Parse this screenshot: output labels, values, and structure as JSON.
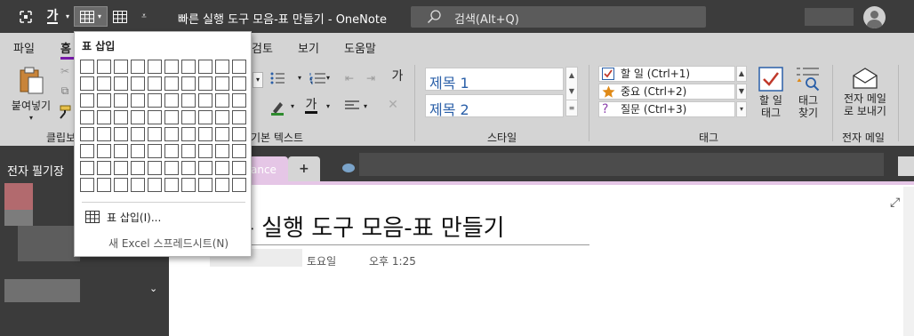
{
  "window": {
    "title": "빠른 실행 도구 모음-표 만들기  -  OneNote",
    "search_placeholder": "검색(Alt+Q)"
  },
  "quick_access": {
    "font_label": "가"
  },
  "ribbon_tabs": [
    "파일",
    "홈",
    "검토",
    "보기",
    "도움말"
  ],
  "ribbon": {
    "paste_label": "붙여넣기",
    "clipboard_group": "클립보",
    "basic_text_group": "기본 텍스트",
    "styles_group": "스타일",
    "tags_group": "태그",
    "email_group": "전자 메일",
    "text_a_label": "가",
    "style_heading1": "제목 1",
    "style_heading2": "제목 2",
    "tags": [
      {
        "label": "할 일 (Ctrl+1)",
        "icon": "checkbox-icon"
      },
      {
        "label": "중요 (Ctrl+2)",
        "icon": "star-icon"
      },
      {
        "label": "질문 (Ctrl+3)",
        "icon": "question-icon"
      }
    ],
    "todo_tag_button": [
      "할 일",
      "태그"
    ],
    "find_tags_button": [
      "태그",
      "찾기"
    ],
    "email_page_button": [
      "전자 메일",
      "로 보내기"
    ]
  },
  "table_dropdown": {
    "header": "표 삽입",
    "grid_rows": 8,
    "grid_cols": 10,
    "insert_table_item": "표 삽입(I)...",
    "new_excel_item": "새 Excel 스프레드시트(N)"
  },
  "left_nav": {
    "title": "전자 필기장"
  },
  "sections": {
    "partial_tab": "ance",
    "add_tab": "+"
  },
  "page": {
    "title": "빠른 실행 도구 모음-표 만들기",
    "visible_title": "른 실행 도구 모음-표 만들기",
    "day": "토요일",
    "time": "오후 1:25"
  },
  "colors": {
    "titlebar": "#3c3c3c",
    "ribbon": "#d4d4d4",
    "section_pink": "#e5c6e6",
    "accent_purple": "#7719aa",
    "style_blue": "#2a5fa8"
  }
}
